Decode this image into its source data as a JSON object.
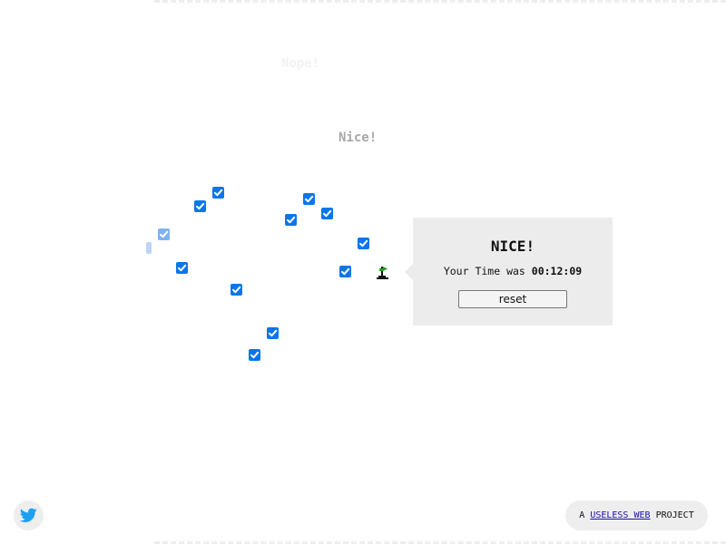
{
  "messages": {
    "faint": "Nope!",
    "nice": "Nice!"
  },
  "popup": {
    "title": "NICE!",
    "time_label": "Your Time was",
    "time_value": "00:12:09",
    "reset_label": "reset"
  },
  "footer": {
    "prefix": "A",
    "link_text": "USELESS WEB",
    "suffix": "PROJECT"
  },
  "icons": {
    "checkbox": "checkbox-checked-icon",
    "flag": "flag-icon",
    "social": "twitter-icon"
  },
  "colors": {
    "checkbox": "#0b76ea",
    "flag": "#1aa31a",
    "twitter": "#1da1f2",
    "popup_bg": "#ececec",
    "link": "#1a0dab"
  },
  "checkboxes": {
    "checked_count": 14,
    "all_checked": true
  }
}
